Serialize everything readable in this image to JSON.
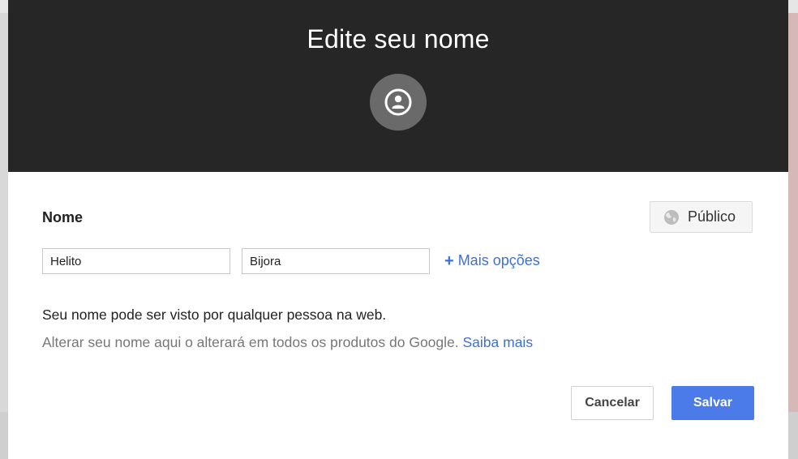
{
  "dialog": {
    "title": "Edite seu nome",
    "avatar_icon": "account-circle-icon"
  },
  "name_section": {
    "label": "Nome",
    "visibility": {
      "icon": "globe-icon",
      "label": "Público"
    },
    "first_name": {
      "value": "Helito",
      "placeholder": ""
    },
    "last_name": {
      "value": "Bijora",
      "placeholder": ""
    },
    "more_options": {
      "icon": "+",
      "label": "Mais opções"
    }
  },
  "notes": {
    "visibility_text": "Seu nome pode ser visto por qualquer pessoa na web.",
    "change_text": "Alterar seu nome aqui o alterará em todos os produtos do Google.",
    "learn_more": "Saiba mais"
  },
  "actions": {
    "cancel_label": "Cancelar",
    "save_label": "Salvar"
  },
  "colors": {
    "header_bg": "#262626",
    "link": "#3f6fd8",
    "primary_button": "#4a7be8"
  }
}
